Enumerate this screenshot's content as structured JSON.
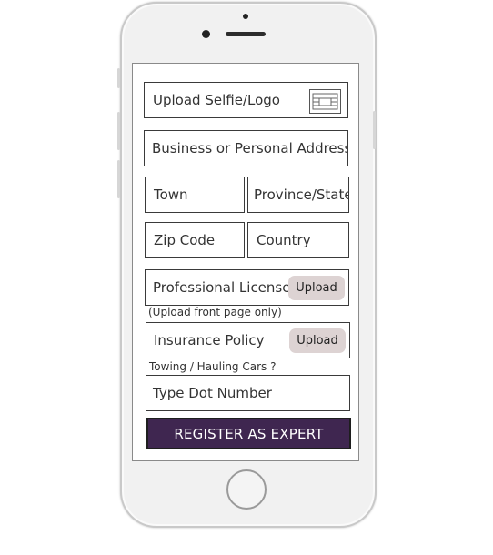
{
  "form": {
    "upload_selfie_label": "Upload Selfie/Logo",
    "address_placeholder": "Business or Personal Address",
    "town_placeholder": "Town",
    "province_placeholder": "Province/State",
    "zip_placeholder": "Zip Code",
    "country_placeholder": "Country",
    "license_label": "Professional License",
    "license_upload_label": "Upload",
    "license_hint": "(Upload front page only)",
    "insurance_label": "Insurance Policy",
    "insurance_upload_label": "Upload",
    "towing_hint": "Towing / Hauling Cars ?",
    "dot_placeholder": "Type Dot Number",
    "register_label": "REGISTER AS EXPERT"
  },
  "colors": {
    "register_button": "#3f2650",
    "upload_button": "#ddd3d3"
  }
}
